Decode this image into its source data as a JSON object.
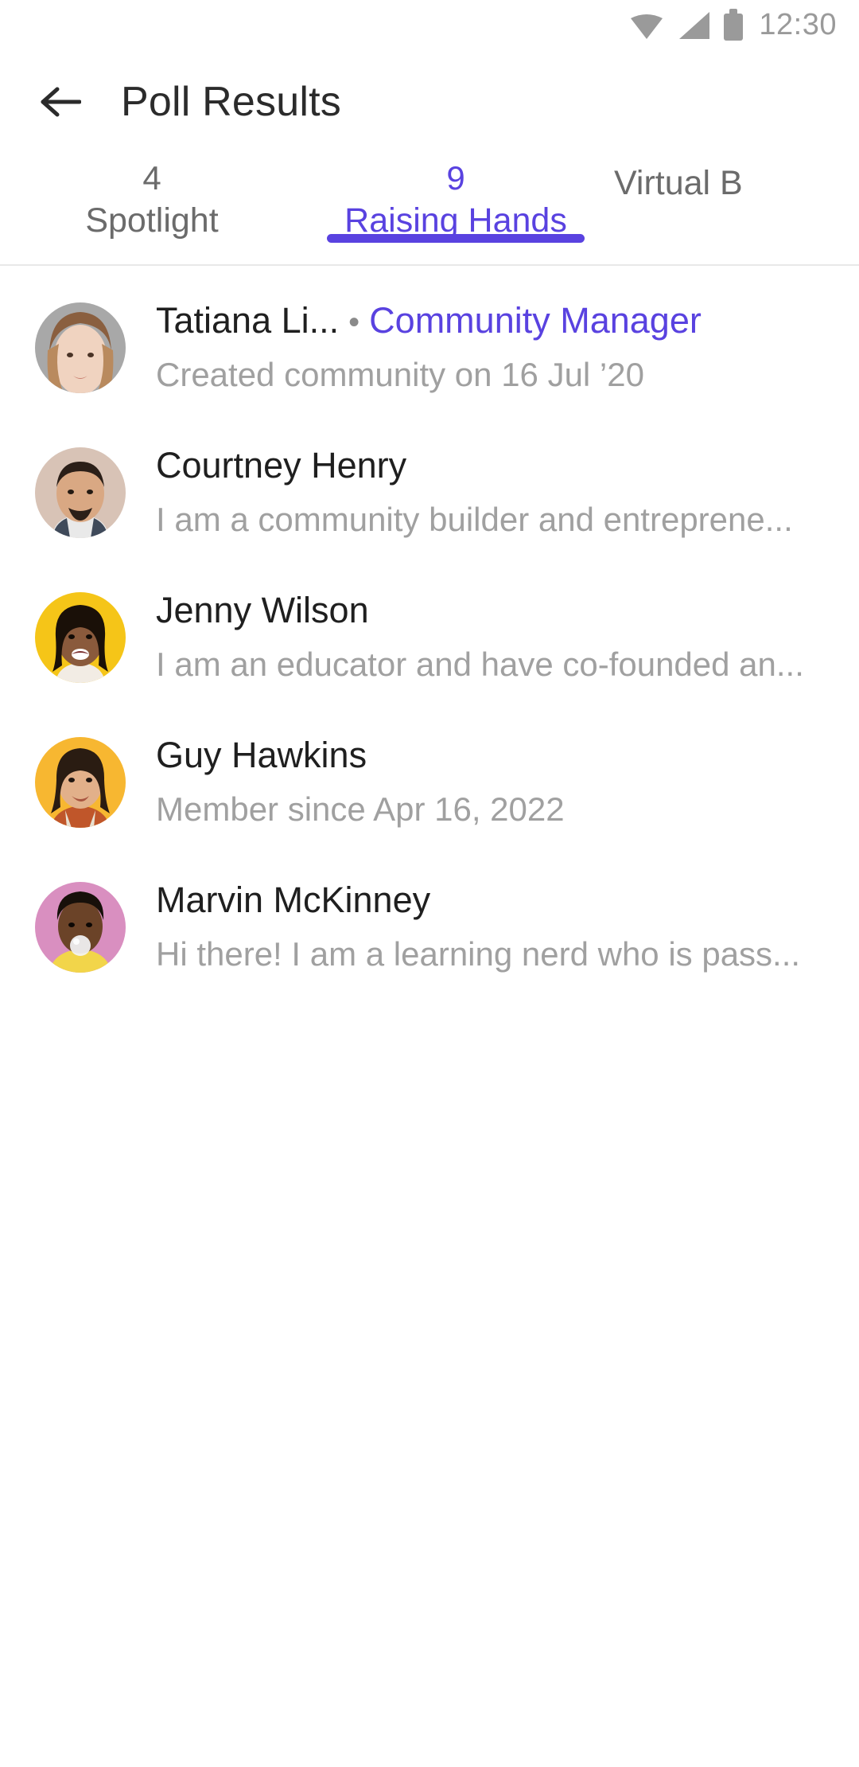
{
  "status_bar": {
    "wifi_icon": "wifi-icon",
    "signal_icon": "signal-icon",
    "battery_icon": "battery-icon",
    "time": "12:30"
  },
  "app_bar": {
    "back_icon": "back-arrow-icon",
    "title": "Poll Results"
  },
  "tabs": [
    {
      "count": "4",
      "label": "Spotlight",
      "active": false
    },
    {
      "count": "9",
      "label": "Raising Hands",
      "active": true
    },
    {
      "count": "",
      "label": "Virtual B",
      "active": false
    }
  ],
  "accent_color": "#5942E0",
  "list": [
    {
      "name": "Tatiana Li...",
      "separator": "•",
      "role": "Community Manager",
      "subtitle": "Created community on 16 Jul ’20",
      "avatar_color": "#a8a8a8",
      "avatar_skin": "#e8c9b4",
      "avatar_hair": "#6b4a34"
    },
    {
      "name": "Courtney Henry",
      "separator": "",
      "role": "",
      "subtitle": "I am a community builder and entreprene...",
      "avatar_color": "#d8c3b6",
      "avatar_skin": "#d9a883",
      "avatar_hair": "#2b1f18"
    },
    {
      "name": "Jenny Wilson",
      "separator": "",
      "role": "",
      "subtitle": "I am an educator and have co-founded an...",
      "avatar_color": "#f5c518",
      "avatar_skin": "#8a5a3c",
      "avatar_hair": "#1a1008"
    },
    {
      "name": "Guy Hawkins",
      "separator": "",
      "role": "",
      "subtitle": "Member since Apr 16, 2022",
      "avatar_color": "#f7b731",
      "avatar_skin": "#e2b08a",
      "avatar_hair": "#2a1c12"
    },
    {
      "name": "Marvin McKinney",
      "separator": "",
      "role": "",
      "subtitle": "Hi there! I am a learning nerd who is pass...",
      "avatar_color": "#d98fc0",
      "avatar_skin": "#6b4328",
      "avatar_hair": "#17100a"
    }
  ]
}
